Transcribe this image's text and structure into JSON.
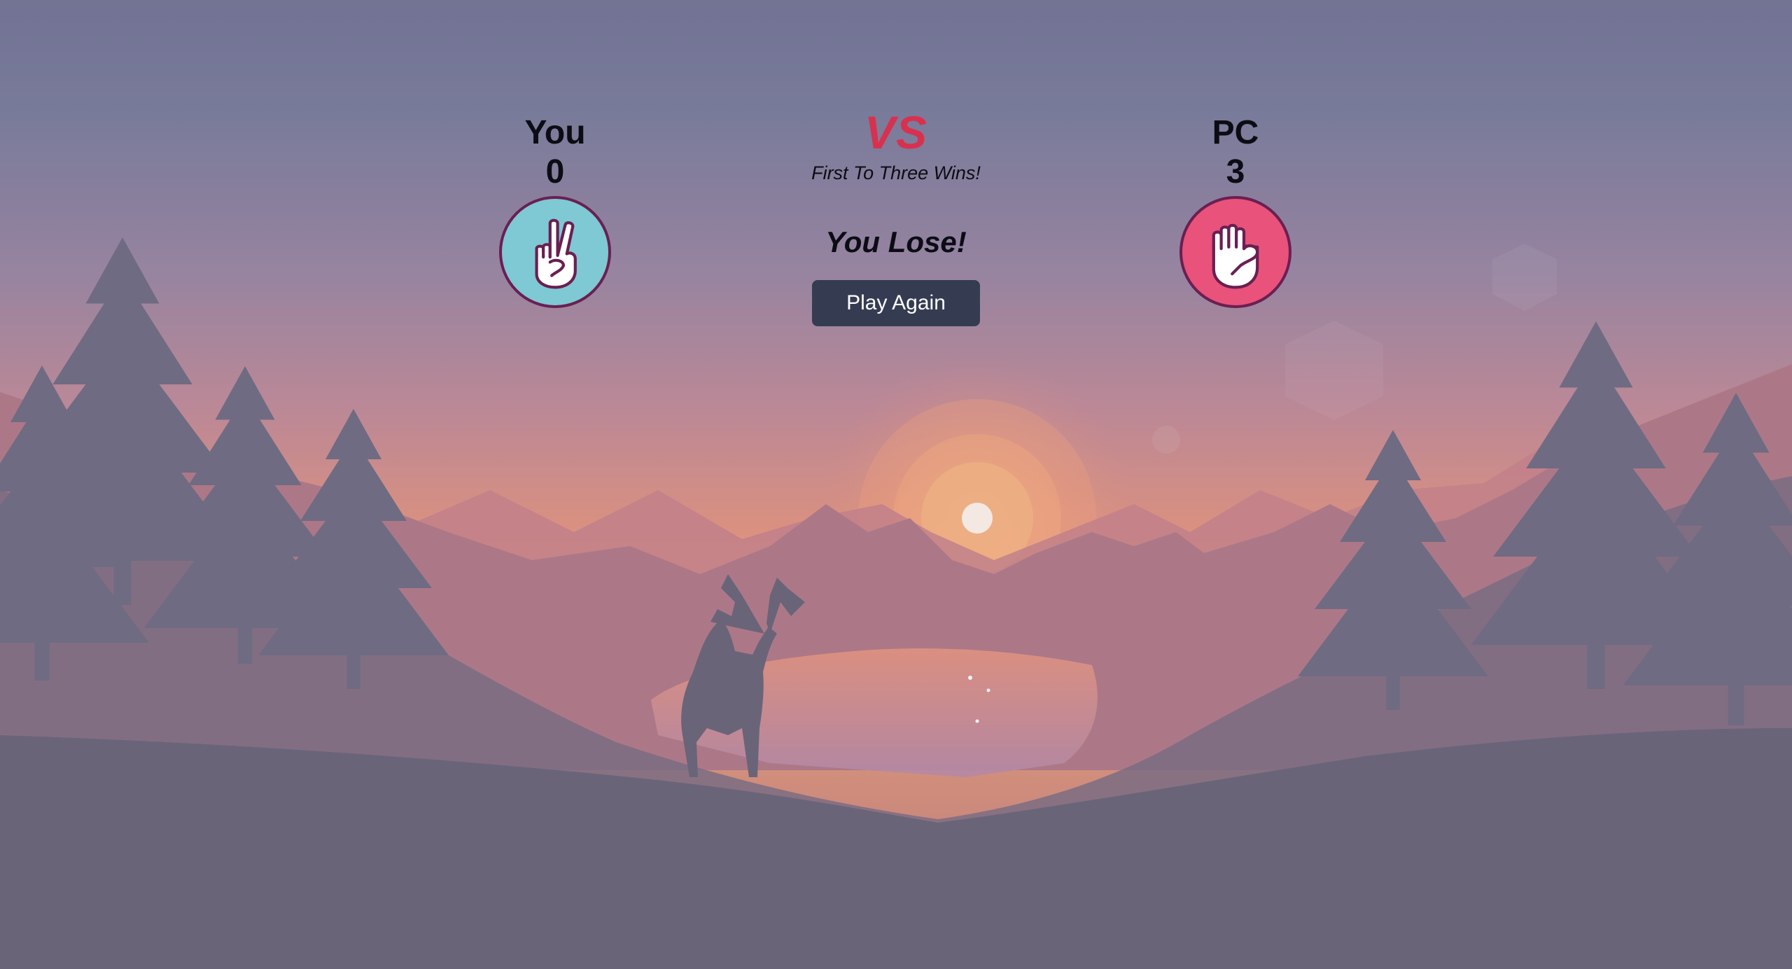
{
  "player": {
    "name": "You",
    "score": "0",
    "choice_icon": "hand-peace-icon",
    "disc_color": "#7ec9d3"
  },
  "computer": {
    "name": "PC",
    "score": "3",
    "choice_icon": "hand-rock-icon",
    "disc_color": "#e9527a"
  },
  "center": {
    "vs": "VS",
    "rule": "First To Three Wins!",
    "result": "You Lose!",
    "play_again_label": "Play Again"
  },
  "colors": {
    "vs_accent": "#d8314f",
    "button_bg": "#353c52",
    "disc_border": "#6a1f52"
  },
  "background": {
    "scene": "sunset-forest-lake-deer-illustration"
  }
}
